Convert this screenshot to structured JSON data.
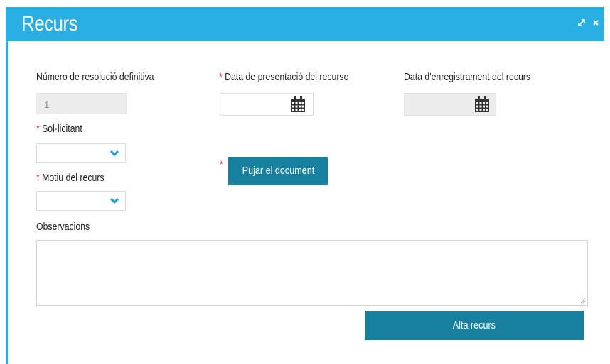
{
  "dialog": {
    "title": "Recurs",
    "controls": {
      "expand_icon": "expand-icon",
      "close_icon": "close-icon"
    }
  },
  "form": {
    "numero_label": "Número de resolució definitiva",
    "numero_value": "1",
    "data_presentacio_label": "Data de presentació del recurso",
    "data_presentacio_value": "",
    "data_enregistrament_label": "Data d'enregistrament del recurs",
    "data_enregistrament_value": "",
    "sollicitant_label": "Sol·licitant",
    "sollicitant_value": "",
    "motiu_label": "Motiu del recurs",
    "motiu_value": "",
    "pujar_button": "Pujar el document",
    "observacions_label": "Observacions",
    "observacions_value": "",
    "required_mark": "*"
  },
  "actions": {
    "submit_label": "Alta recurs"
  },
  "colors": {
    "titlebar": "#29aee3",
    "button": "#17809f",
    "required": "#d8322b",
    "caret": "#1a9ad6"
  }
}
